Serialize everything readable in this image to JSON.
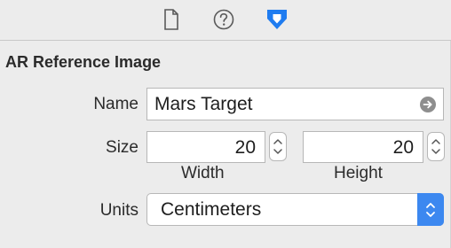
{
  "toolbar": {
    "icons": [
      "file-inspector-icon",
      "quick-help-icon",
      "attributes-inspector-icon"
    ],
    "selected": "attributes-inspector-icon",
    "accent": "#1f7cf0"
  },
  "section": {
    "title": "AR Reference Image"
  },
  "name_row": {
    "label": "Name",
    "value": "Mars Target"
  },
  "size_row": {
    "label": "Size",
    "width_value": "20",
    "height_value": "20",
    "width_label": "Width",
    "height_label": "Height"
  },
  "units_row": {
    "label": "Units",
    "value": "Centimeters"
  }
}
